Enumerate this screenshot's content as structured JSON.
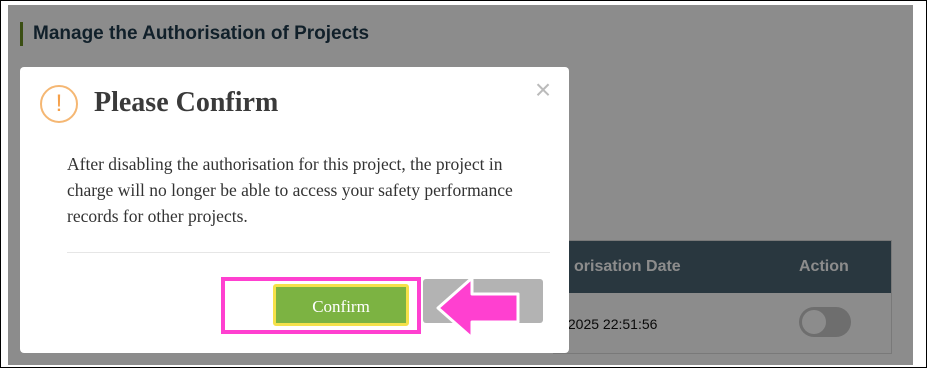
{
  "page": {
    "section_title": "Manage the Authorisation of Projects"
  },
  "table": {
    "headers": {
      "authorisation_date": "orisation Date",
      "action": "Action"
    },
    "rows": [
      {
        "authorisation_date": "/2025 22:51:56",
        "action_toggle": "off"
      }
    ]
  },
  "dialog": {
    "icon": "exclamation-circle-icon",
    "title": "Please Confirm",
    "message": "After disabling the authorisation for this project, the project in charge will no longer be able to access your safety performance records for other projects.",
    "close_icon": "close-icon",
    "confirm_label": "Confirm"
  },
  "annotation": {
    "highlight_color": "#ff40d0",
    "arrow_icon": "left-arrow-icon"
  },
  "colors": {
    "accent_green": "#7cb342",
    "header_dark": "#4c6473",
    "title_bar_green": "#6b8e23"
  }
}
